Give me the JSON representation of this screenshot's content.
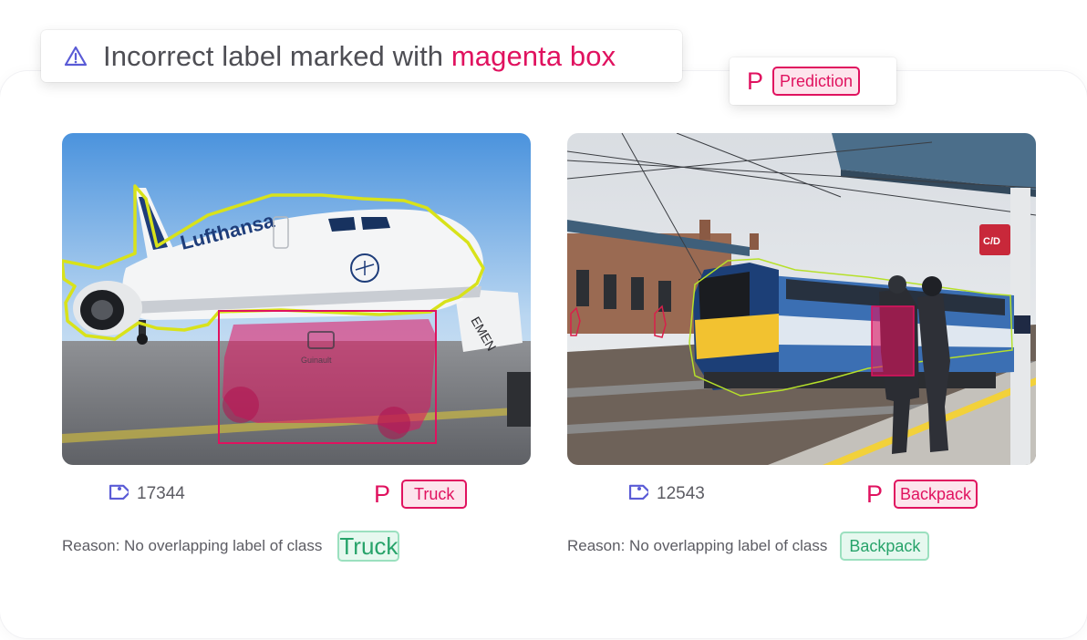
{
  "callout": {
    "icon": "warning-icon",
    "prefix": "Incorrect label marked with ",
    "highlight": "magenta box",
    "highlight_color": "#e0125f"
  },
  "legend": {
    "marker": "P",
    "label": "Prediction"
  },
  "colors": {
    "prediction": "#e0125f",
    "ground_truth": "#27a36a",
    "outline": "#d8e21a",
    "icon": "#5a5bd6"
  },
  "examples": [
    {
      "image": "airplane-scene",
      "id": "17344",
      "marker": "P",
      "prediction": "Truck",
      "reason_text": "Reason: No overlapping label of class",
      "reason_class": "Truck"
    },
    {
      "image": "train-station-scene",
      "id": "12543",
      "marker": "P",
      "prediction": "Backpack",
      "reason_text": "Reason: No overlapping label of class",
      "reason_class": "Backpack"
    }
  ]
}
